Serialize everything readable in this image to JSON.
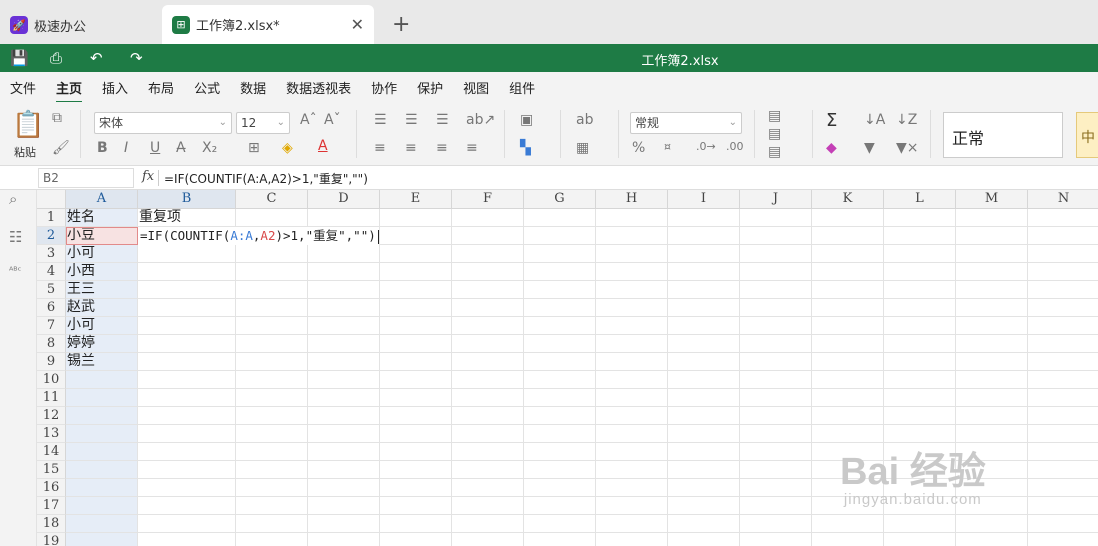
{
  "tabs": [
    {
      "label": "极速办公",
      "icon": "rocket-icon"
    },
    {
      "label": "工作簿2.xlsx*",
      "icon": "spreadsheet-icon"
    }
  ],
  "titlebar": {
    "title": "工作簿2.xlsx"
  },
  "menu": [
    "文件",
    "主页",
    "插入",
    "布局",
    "公式",
    "数据",
    "数据透视表",
    "协作",
    "保护",
    "视图",
    "组件"
  ],
  "menu_active": "主页",
  "ribbon": {
    "paste_label": "粘贴",
    "font_name": "宋体",
    "font_size": "12",
    "number_format": "常规",
    "style_normal": "正常",
    "style_medium": "中"
  },
  "formula_bar": {
    "name_box": "B2",
    "fx_label": "fx",
    "formula": "=IF(COUNTIF(A:A,A2)>1,\"重复\",\"\")"
  },
  "editing": {
    "prefix": "=IF(COUNTIF(",
    "ref1": "A:A",
    "comma": ",",
    "ref2": "A2",
    "suffix": ")>1,\"重复\",\"\")"
  },
  "columns": [
    "A",
    "B",
    "C",
    "D",
    "E",
    "F",
    "G",
    "H",
    "I",
    "J",
    "K",
    "L",
    "M",
    "N"
  ],
  "rows": [
    "1",
    "2",
    "3",
    "4",
    "5",
    "6",
    "7",
    "8",
    "9",
    "10",
    "11",
    "12",
    "13",
    "14",
    "15",
    "16",
    "17",
    "18",
    "19"
  ],
  "cells": {
    "A": [
      "姓名",
      "小豆",
      "小可",
      "小西",
      "王三",
      "赵武",
      "小可",
      "婷婷",
      "锡兰"
    ],
    "B1": "重复项"
  },
  "watermark": {
    "main": "Bai 经验",
    "sub": "jingyan.baidu.com"
  }
}
